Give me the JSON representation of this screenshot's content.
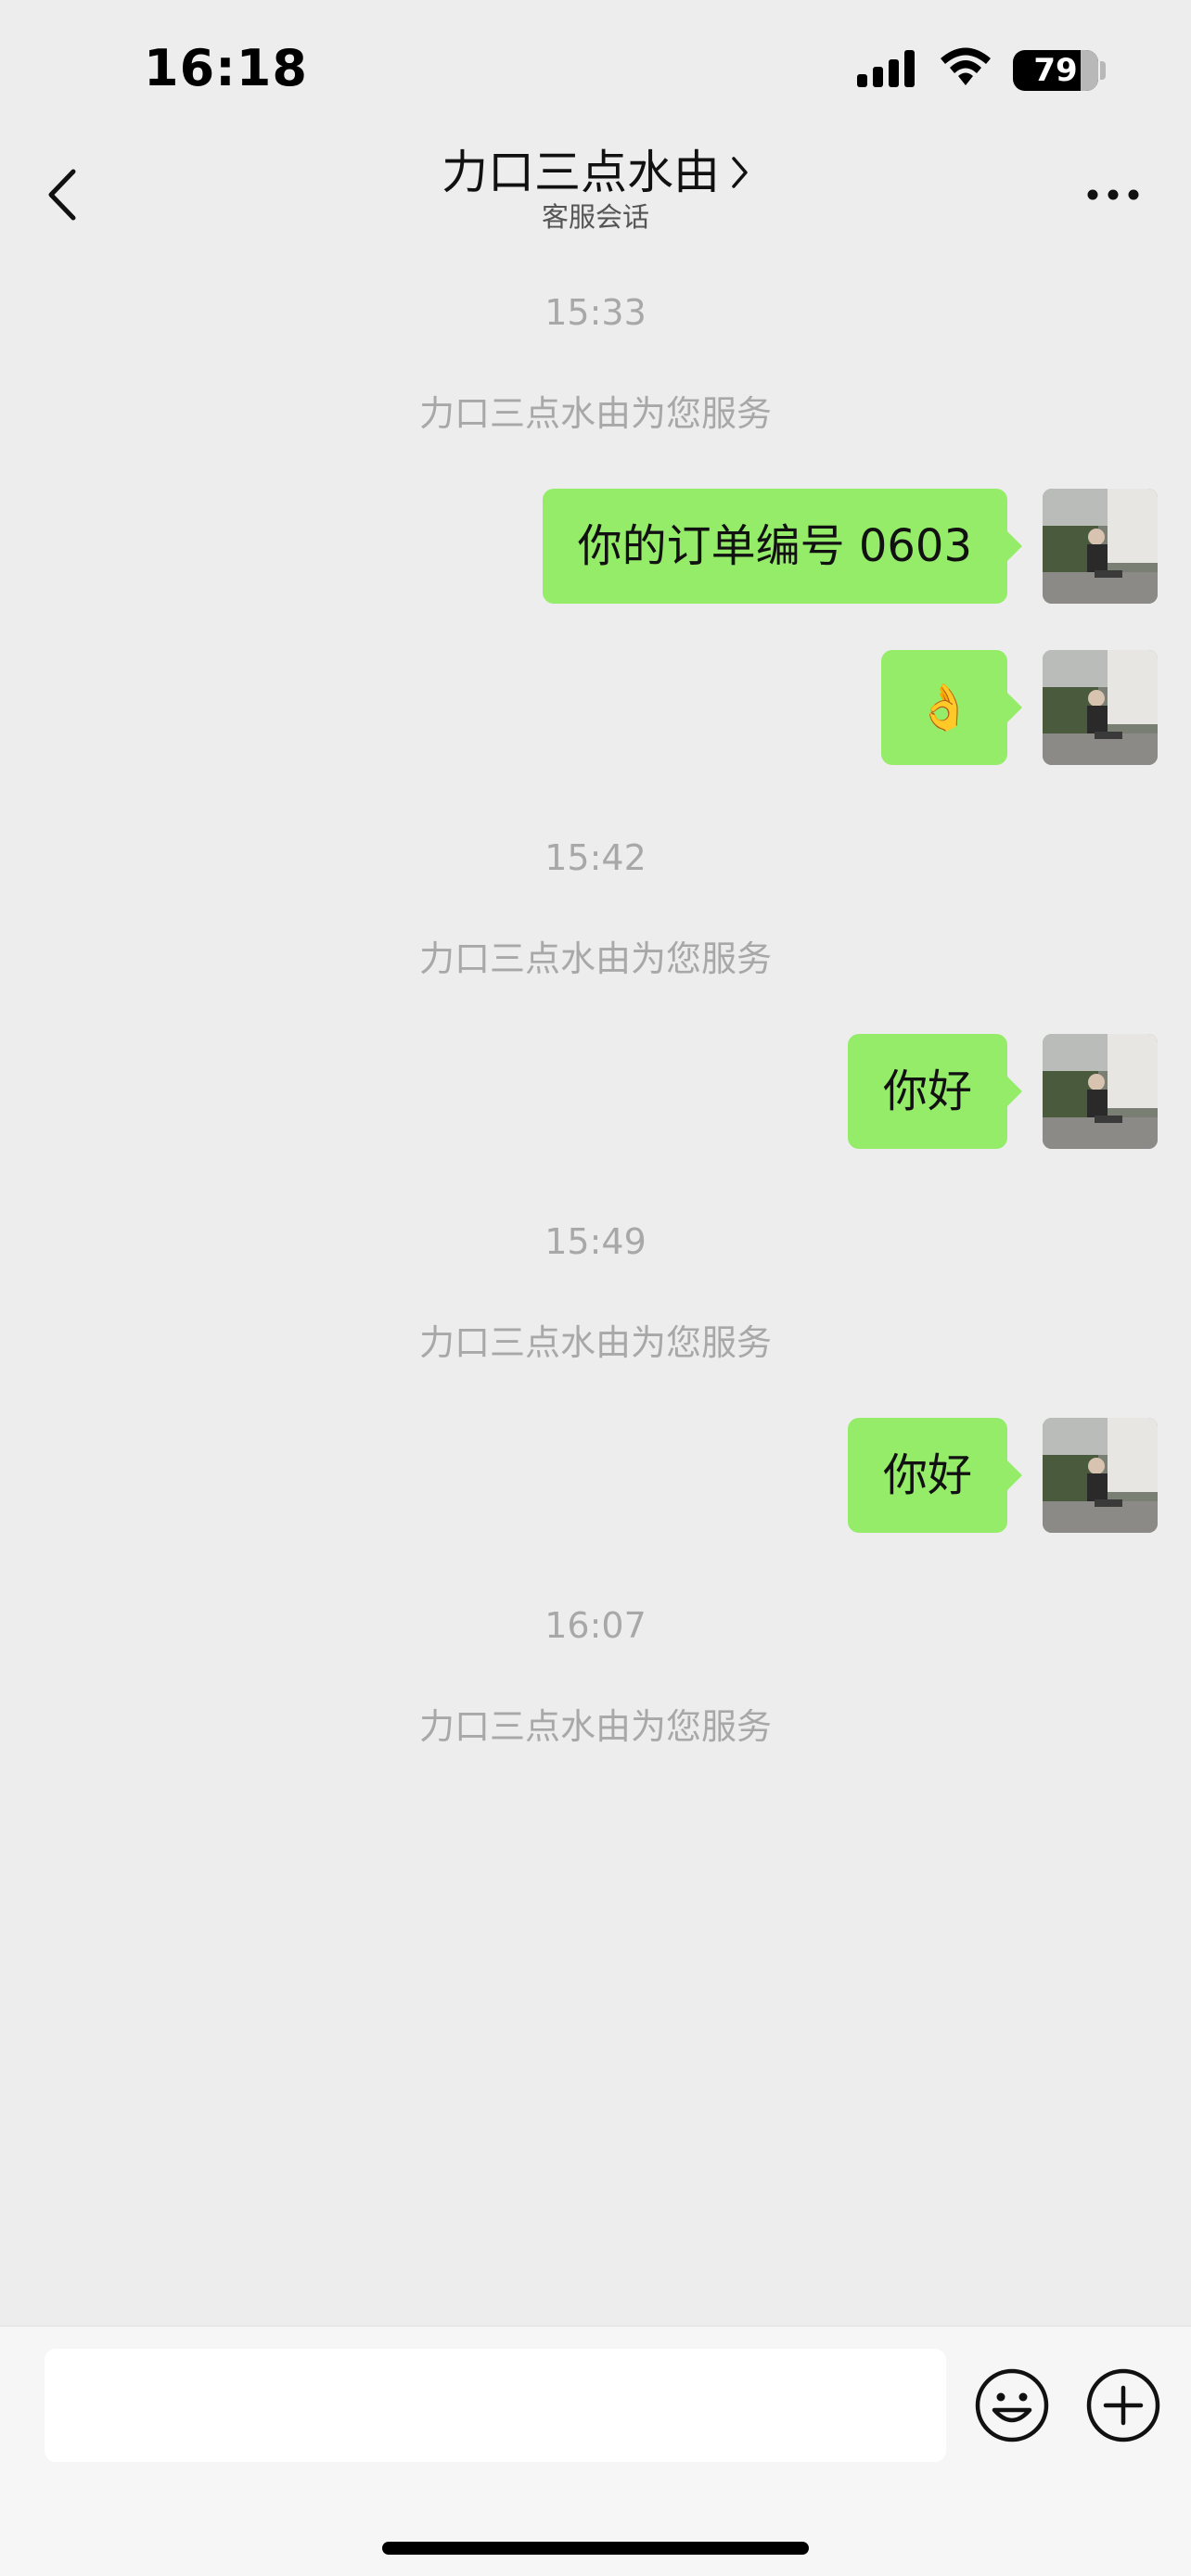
{
  "status_bar": {
    "time": "16:18",
    "battery": "79",
    "battery_level_percent": 79
  },
  "header": {
    "title": "力口三点水由",
    "subtitle": "客服会话"
  },
  "icons": {
    "back": "chevron-left-icon",
    "title_more": "chevron-right-icon",
    "more": "ellipsis-icon",
    "emoji": "smiley-icon",
    "plus": "plus-circle-icon"
  },
  "messages": [
    {
      "time": "15:33",
      "note": "力口三点水由为您服务"
    },
    {
      "bubble": "你的订单编号 0603"
    },
    {
      "bubble": "👌"
    },
    {
      "time": "15:42",
      "note": "力口三点水由为您服务"
    },
    {
      "bubble": "你好"
    },
    {
      "time": "15:49",
      "note": "力口三点水由为您服务"
    },
    {
      "bubble": "你好"
    },
    {
      "time": "16:07",
      "note": "力口三点水由为您服务"
    }
  ],
  "colors": {
    "bubble": "#95ec69",
    "background": "#ededed",
    "meta_text": "#a8a8a8"
  },
  "input": {
    "value": "",
    "placeholder": ""
  }
}
